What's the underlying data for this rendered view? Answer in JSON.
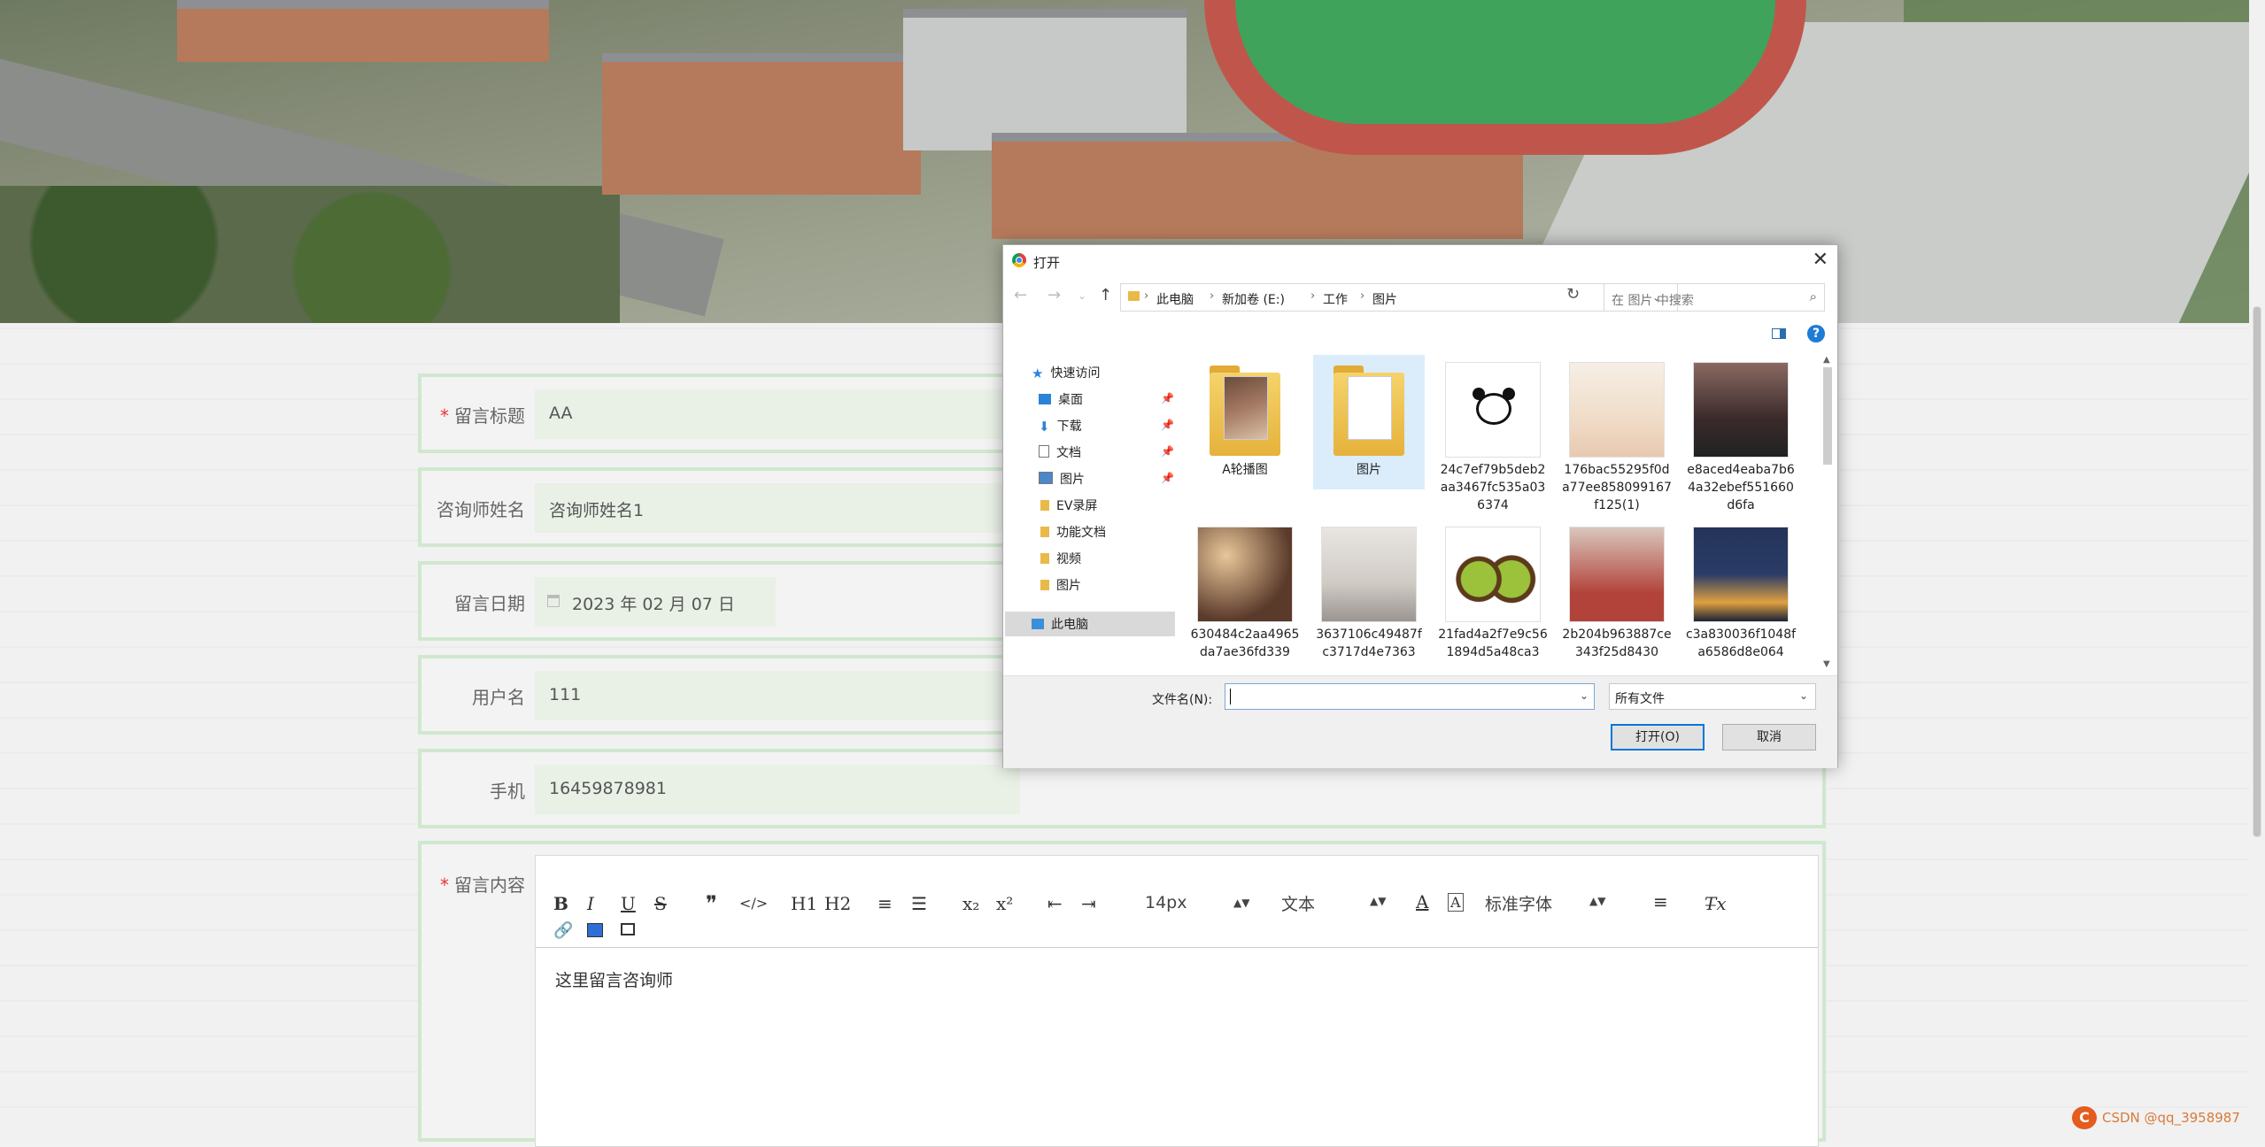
{
  "form": {
    "title_label": "留言标题",
    "title_value": "AA",
    "consultant_label": "咨询师姓名",
    "consultant_value": "咨询师姓名1",
    "date_label": "留言日期",
    "date_value": "2023 年 02 月 07 日",
    "username_label": "用户名",
    "username_value": "111",
    "phone_label": "手机",
    "phone_value": "16459878981",
    "content_label": "留言内容",
    "required_mark": "*"
  },
  "editor": {
    "tools": [
      "B",
      "I",
      "U",
      "S",
      "❞",
      "</>",
      "H1",
      "H2",
      "≡",
      "☰",
      "x₂",
      "x²",
      "⇤",
      "⇥"
    ],
    "font_size": "14px",
    "text_style": "文本",
    "font_family": "标准字体",
    "body_text": "这里留言咨询师"
  },
  "dialog": {
    "title": "打开",
    "path": [
      "此电脑",
      "新加卷 (E:)",
      "工作",
      "图片"
    ],
    "search_placeholder": "在 图片 中搜索",
    "tree": {
      "quick_access": "快速访问",
      "desktop": "桌面",
      "downloads": "下载",
      "documents": "文档",
      "pictures": "图片",
      "ev": "EV录屏",
      "func_docs": "功能文档",
      "videos": "视频",
      "pictures2": "图片",
      "this_pc": "此电脑"
    },
    "files": [
      {
        "name": "A轮播图",
        "kind": "folder"
      },
      {
        "name": "图片",
        "kind": "folder"
      },
      {
        "name": "24c7ef79b5deb2aa3467fc535a036374",
        "kind": "image-panda"
      },
      {
        "name": "176bac55295f0da77ee858099167f125(1)",
        "kind": "image-anime"
      },
      {
        "name": "e8aced4eaba7b64a32ebef551660d6fa",
        "kind": "image-car"
      },
      {
        "name": "630484c2aa4965da7ae36fd339",
        "kind": "image-girl"
      },
      {
        "name": "3637106c49487fc3717d4e7363",
        "kind": "image-room"
      },
      {
        "name": "21fad4a2f7e9c561894d5a48ca3",
        "kind": "image-kiwi"
      },
      {
        "name": "2b204b963887ce343f25d8430",
        "kind": "image-woman"
      },
      {
        "name": "c3a830036f1048fa6586d8e064",
        "kind": "image-night"
      }
    ],
    "filename_label": "文件名(N):",
    "filename_value": "",
    "filetype": "所有文件",
    "open_button": "打开(O)",
    "cancel_button": "取消"
  },
  "watermark": "CSDN @qq_3958987"
}
